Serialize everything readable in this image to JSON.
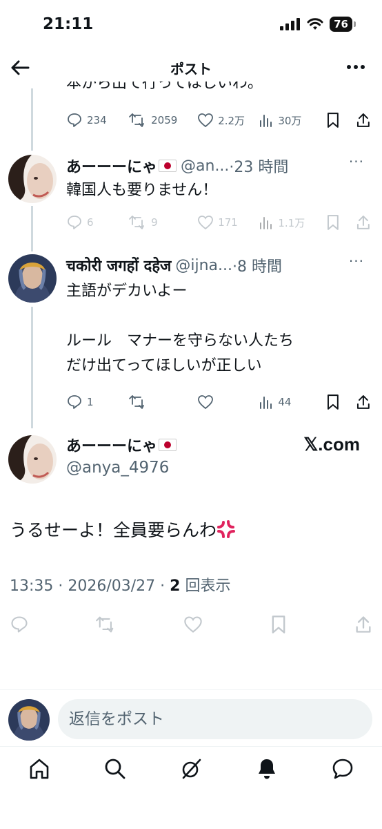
{
  "status_bar": {
    "time": "21:11",
    "battery": "76"
  },
  "header": {
    "title": "ポスト"
  },
  "prev_tweet": {
    "cut_text": "本から出て行ってほしいわ。",
    "stats": {
      "replies": "234",
      "reposts": "2059",
      "likes": "2.2万",
      "views": "30万"
    }
  },
  "reply1": {
    "name": "あーーーにゃ",
    "handle": "@an...",
    "time": "·23 時間",
    "text": "韓国人も要りません！",
    "stats": {
      "replies": "6",
      "reposts": "9",
      "likes": "171",
      "views": "1.1万"
    }
  },
  "reply2": {
    "name": "चकोरी जगहों दहेज",
    "handle": "@ijna...",
    "time": "·8 時間",
    "text_lines": [
      "主語がデカいよー",
      "",
      "ルール　マナーを守らない人たち",
      "だけ出てってほしいが正しい"
    ],
    "stats": {
      "replies": "1",
      "reposts": "",
      "likes": "",
      "views": "44"
    }
  },
  "main_tweet": {
    "name": "あーーーにゃ",
    "handle": "@anya_4976",
    "watermark": "𝕏.com",
    "text": "うるせーよ！全員要らんわ",
    "meta_time": "13:35 · 2026/03/27 · ",
    "meta_views": "2",
    "meta_views_label": " 回表示"
  },
  "reply_box": {
    "placeholder": "返信をポスト"
  },
  "icons": {
    "nav": [
      "home-icon",
      "search-icon",
      "grok-icon",
      "notifications-icon",
      "messages-icon"
    ]
  },
  "colors": {
    "text": "#0f1419",
    "secondary": "#536471",
    "divider": "#eff3f4",
    "thread_line": "#cfd9de"
  }
}
